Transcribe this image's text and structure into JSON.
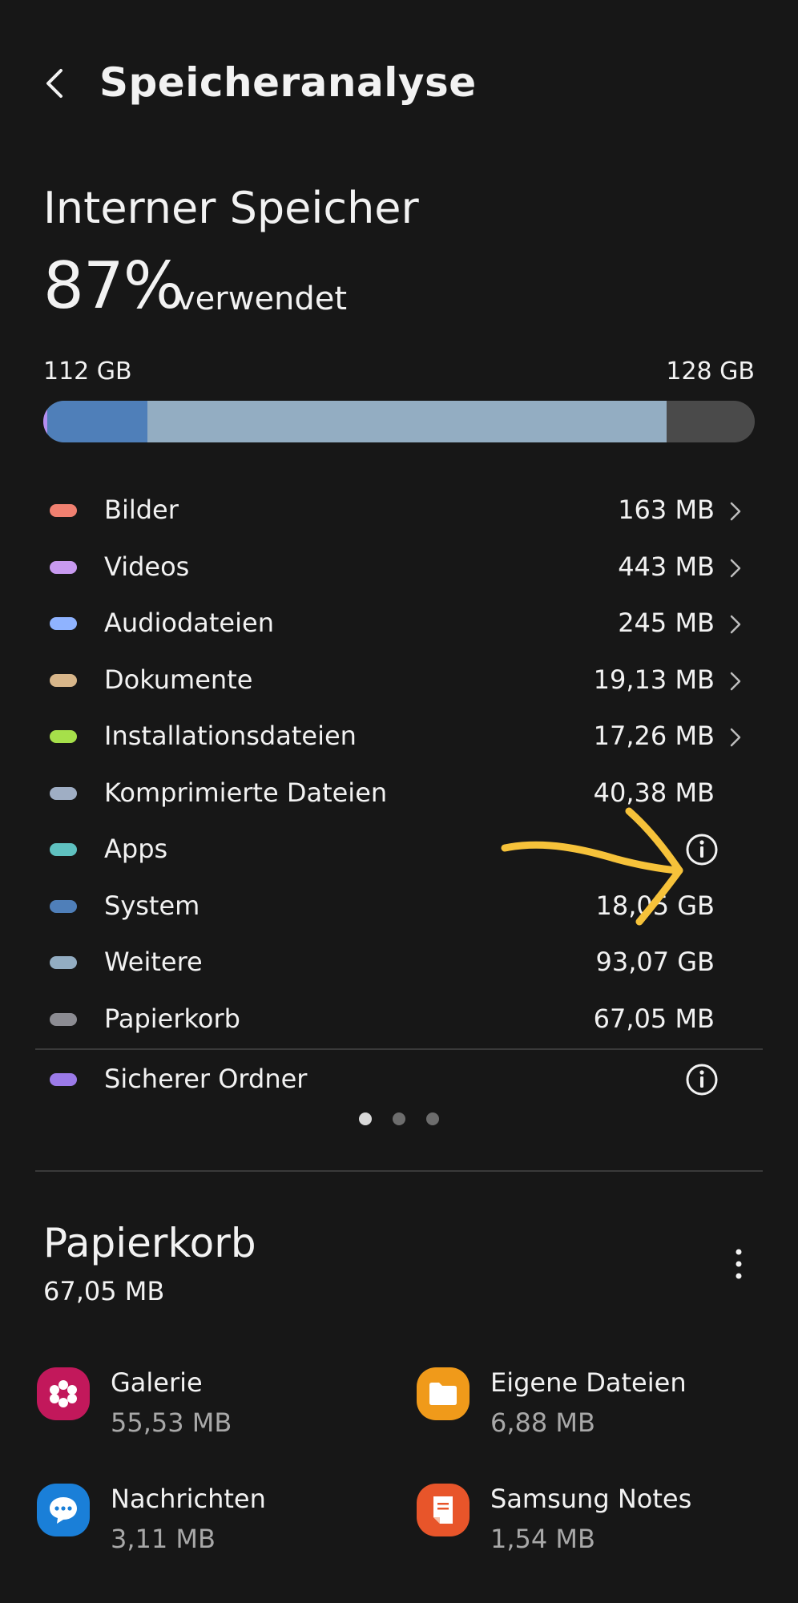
{
  "header": {
    "title": "Speicheranalyse"
  },
  "storage": {
    "title": "Interner Speicher",
    "used_percent": "87%",
    "used_suffix": "verwendet",
    "used_label": "112 GB",
    "total_label": "128 GB"
  },
  "usage_bar": {
    "used_fraction": 0.87,
    "segments": [
      {
        "color": "#b48ef0",
        "fraction": 0.006
      },
      {
        "color": "#4f7fb9",
        "fraction": 0.14
      },
      {
        "color": "#93adc2",
        "fraction": 0.73
      }
    ],
    "remaining_color": "#4a4a4a"
  },
  "categories": [
    {
      "label": "Bilder",
      "value": "163 MB",
      "color": "#f08070",
      "chevron": true
    },
    {
      "label": "Videos",
      "value": "443 MB",
      "color": "#c89af0",
      "chevron": true
    },
    {
      "label": "Audiodateien",
      "value": "245 MB",
      "color": "#8fb3ff",
      "chevron": true
    },
    {
      "label": "Dokumente",
      "value": "19,13 MB",
      "color": "#d8b68a",
      "chevron": true
    },
    {
      "label": "Installationsdateien",
      "value": "17,26 MB",
      "color": "#a6e04a",
      "chevron": true
    },
    {
      "label": "Komprimierte Dateien",
      "value": "40,38 MB",
      "color": "#9faec4",
      "chevron": false
    },
    {
      "label": "Apps",
      "value": "",
      "color": "#5fc1c0",
      "info": true
    },
    {
      "label": "System",
      "value": "18,05 GB",
      "color": "#4f7fb9",
      "chevron": false
    },
    {
      "label": "Weitere",
      "value": "93,07 GB",
      "color": "#93adc2",
      "chevron": false
    },
    {
      "label": "Papierkorb",
      "value": "67,05 MB",
      "color": "#8c8c92",
      "chevron": false
    }
  ],
  "secure_folder": {
    "label": "Sicherer Ordner",
    "color": "#9b7ae8"
  },
  "pager": {
    "count": 3,
    "active": 0
  },
  "trash": {
    "title": "Papierkorb",
    "size": "67,05 MB",
    "apps": [
      {
        "name": "Galerie",
        "size": "55,53 MB",
        "icon": "gallery-icon",
        "color": "#c2185b"
      },
      {
        "name": "Eigene Dateien",
        "size": "6,88 MB",
        "icon": "folder-icon",
        "color": "#f09a1a"
      },
      {
        "name": "Nachrichten",
        "size": "3,11 MB",
        "icon": "messages-icon",
        "color": "#1a7fd8"
      },
      {
        "name": "Samsung Notes",
        "size": "1,54 MB",
        "icon": "notes-icon",
        "color": "#e8552a"
      }
    ]
  },
  "annotation": {
    "color": "#f6c23a"
  }
}
